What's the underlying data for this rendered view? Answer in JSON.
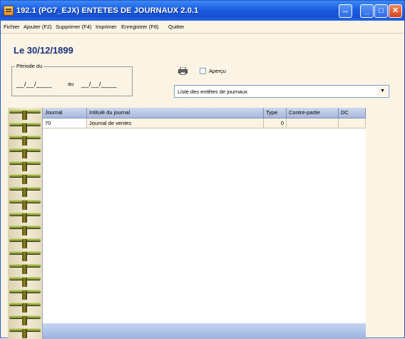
{
  "window": {
    "title": "192.1  (PG7_EJX) ENTETES DE JOURNAUX 2.0.1",
    "buttons": {
      "restore": "↔",
      "minimize": "_",
      "maximize": "□",
      "close": "✕"
    }
  },
  "menu": [
    {
      "label": "Fichier"
    },
    {
      "label": "Ajouter (F2)"
    },
    {
      "label": "Supprimer (F4)"
    },
    {
      "label": "Imprimer"
    },
    {
      "label": "Enregistrer (F8)"
    },
    {
      "label": "Quitter"
    }
  ],
  "header": {
    "date_label": "Le  30/12/1899"
  },
  "period": {
    "legend": "Période du",
    "from_value": "__/__/____",
    "to_label": "au",
    "to_value": "__/__/____"
  },
  "print": {
    "icon": "printer-icon",
    "apercu_label": "Aperçu",
    "apercu_checked": false
  },
  "list_select": {
    "value": "Liste des entêtes de journaux"
  },
  "grid": {
    "columns": [
      "Journal",
      "Intitulé du journal",
      "Type",
      "Contre-partie",
      "DC"
    ],
    "rows": [
      {
        "journal": "70",
        "intitule": "Journal de ventes",
        "type": "0",
        "contrepartie": "",
        "dc": ""
      }
    ]
  },
  "colors": {
    "accent": "#1a5ce0",
    "background": "#fbf4e4",
    "header_text": "#1b2f7a"
  }
}
